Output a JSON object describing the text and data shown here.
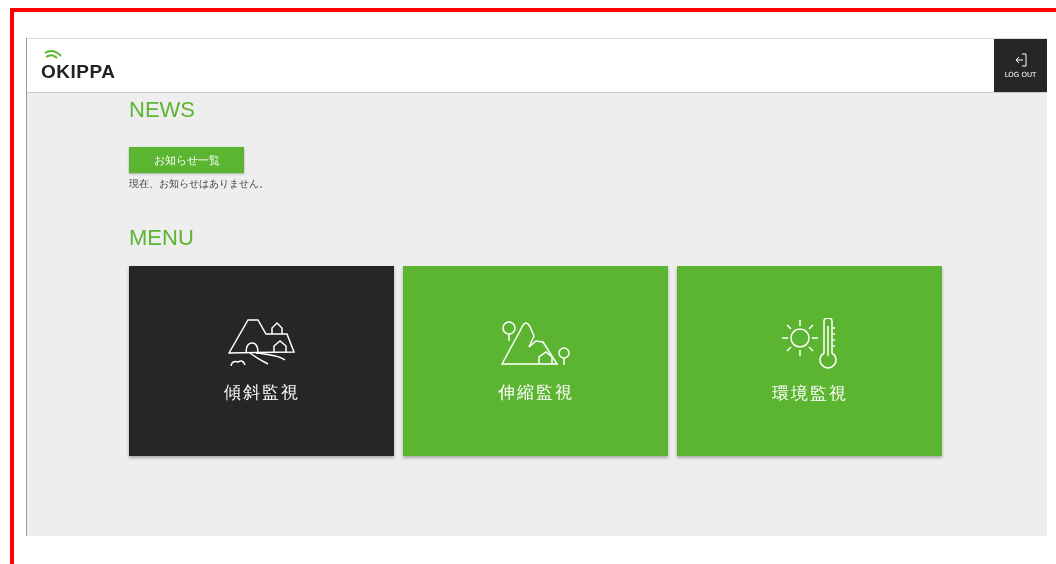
{
  "header": {
    "logo": "OKIPPA",
    "logout": "LOG OUT"
  },
  "news": {
    "title": "NEWS",
    "button": "お知らせ一覧",
    "message": "現在、お知らせはありません。"
  },
  "menu": {
    "title": "MENU",
    "items": [
      {
        "kind": "slope",
        "label": "傾斜監視",
        "selected": true
      },
      {
        "kind": "mountain",
        "label": "伸縮監視",
        "selected": false
      },
      {
        "kind": "weather",
        "label": "環境監視",
        "selected": false
      }
    ]
  }
}
